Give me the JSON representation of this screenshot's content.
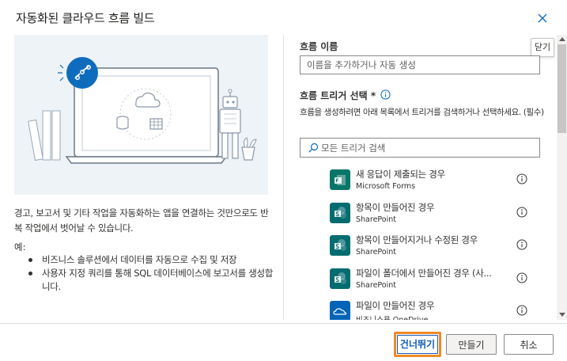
{
  "dialog": {
    "title": "자동화된 클라우드 흐름 빌드",
    "close_tooltip": "닫기"
  },
  "left": {
    "description": "경고, 보고서 및 기타 작업을 자동화하는 앱을 연결하는 것만으로도 반복 작업에서 벗어날 수 있습니다.",
    "example_label": "예:",
    "examples": [
      "비즈니스 솔루션에서 데이터를 자동으로 수집 및 저장",
      "사용자 지정 쿼리를 통해 SQL 데이터베이스에 보고서를 생성합니다."
    ]
  },
  "form": {
    "flow_name_label": "흐름 이름",
    "flow_name_placeholder": "이름을 추가하거나 자동 생성",
    "trigger_label": "흐름 트리거 선택 *",
    "trigger_help": "흐름을 생성하려면 아래 목록에서 트리거를 검색하거나 선택하세요. (필수)",
    "search_placeholder": "모든 트리거 검색"
  },
  "triggers": [
    {
      "name": "새 응답이 제출되는 경우",
      "connector": "Microsoft Forms",
      "icon": "forms-icon",
      "color": "#077568"
    },
    {
      "name": "항목이 만들어진 경우",
      "connector": "SharePoint",
      "icon": "sharepoint-icon",
      "color": "#036c70"
    },
    {
      "name": "항목이 만들어지거나 수정된 경우",
      "connector": "SharePoint",
      "icon": "sharepoint-icon",
      "color": "#036c70"
    },
    {
      "name": "파일이 폴더에서 만들어진 경우 (사...",
      "connector": "SharePoint",
      "icon": "sharepoint-icon",
      "color": "#036c70"
    },
    {
      "name": "파일이 만들어진 경우",
      "connector": "비즈니스용 OneDrive",
      "icon": "onedrive-icon",
      "color": "#0364b8"
    }
  ],
  "footer": {
    "skip_label": "건너뛰기",
    "create_label": "만들기",
    "cancel_label": "취소"
  },
  "colors": {
    "accent": "#0f6cbd",
    "highlight": "#f08a24"
  }
}
